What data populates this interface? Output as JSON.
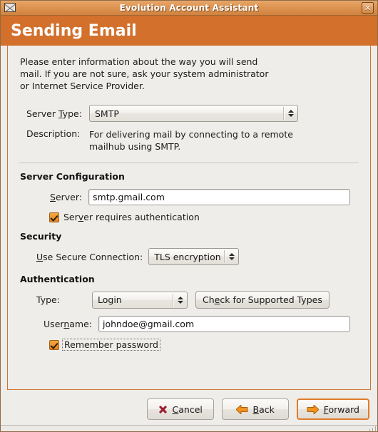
{
  "window": {
    "title": "Evolution Account Assistant",
    "icon": "envelope-icon",
    "close_label": "✕"
  },
  "banner": {
    "title": "Sending Email",
    "color": "#d2702c"
  },
  "intro": {
    "text": "Please enter information about the way you will send mail. If you are not sure, ask your system administrator or Internet Service Provider."
  },
  "server_type": {
    "label_pre": "Server ",
    "label_acc": "T",
    "label_post": "ype:",
    "value": "SMTP"
  },
  "description": {
    "label": "Description:",
    "text": "For delivering mail by connecting to a remote mailhub using SMTP."
  },
  "server_configuration": {
    "heading": "Server Configuration",
    "server_label_pre": "",
    "server_label_acc": "S",
    "server_label_post": "erver:",
    "server_value": "smtp.gmail.com",
    "requires_auth_pre": "Ser",
    "requires_auth_acc": "v",
    "requires_auth_post": "er requires authentication",
    "requires_auth_checked": "true"
  },
  "security": {
    "heading": "Security",
    "secure_label_pre": "",
    "secure_label_acc": "U",
    "secure_label_post": "se Secure Connection:",
    "secure_value": "TLS encryption"
  },
  "authentication": {
    "heading": "Authentication",
    "type_label": "Type:",
    "type_value": "Login",
    "check_btn_pre": "Ch",
    "check_btn_acc": "e",
    "check_btn_post": "ck for Supported Types",
    "username_label_pre": "User",
    "username_label_acc": "n",
    "username_label_post": "ame:",
    "username_value": "johndoe@gmail.com",
    "remember_label": "Remember password",
    "remember_checked": "true"
  },
  "actions": {
    "cancel_pre": "",
    "cancel_acc": "C",
    "cancel_post": "ancel",
    "back_pre": "",
    "back_acc": "B",
    "back_post": "ack",
    "forward_pre": "",
    "forward_acc": "F",
    "forward_post": "orward"
  },
  "colors": {
    "accent": "#d2702c",
    "titlebar": "#dd9452",
    "checkbox": "#e8841f",
    "arrow": "#f0921e"
  }
}
